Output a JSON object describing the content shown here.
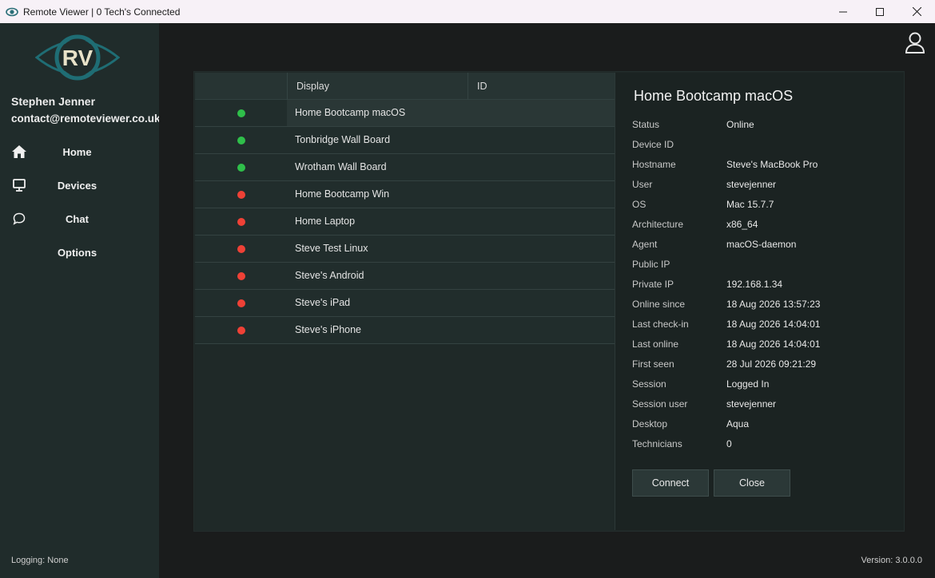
{
  "window": {
    "title": "Remote Viewer | 0 Tech's Connected"
  },
  "sidebar": {
    "logo_text": "RV",
    "user_name": "Stephen Jenner",
    "user_email": "contact@remoteviewer.co.uk",
    "nav": [
      {
        "label": "Home",
        "icon": "home-icon"
      },
      {
        "label": "Devices",
        "icon": "monitor-icon"
      },
      {
        "label": "Chat",
        "icon": "chat-icon"
      },
      {
        "label": "Options",
        "icon": ""
      }
    ],
    "logging": "Logging: None"
  },
  "footer": {
    "version": "Version: 3.0.0.0"
  },
  "table": {
    "columns": [
      "",
      "Display",
      "ID"
    ],
    "rows": [
      {
        "display": "Home Bootcamp macOS",
        "status": "online"
      },
      {
        "display": "Tonbridge Wall Board",
        "status": "online"
      },
      {
        "display": "Wrotham Wall Board",
        "status": "online"
      },
      {
        "display": "Home Bootcamp Win",
        "status": "offline"
      },
      {
        "display": "Home Laptop",
        "status": "offline"
      },
      {
        "display": "Steve Test Linux",
        "status": "offline"
      },
      {
        "display": "Steve's Android",
        "status": "offline"
      },
      {
        "display": "Steve's iPad",
        "status": "offline"
      },
      {
        "display": "Steve's iPhone",
        "status": "offline"
      }
    ],
    "selected_index": 0
  },
  "details": {
    "title": "Home Bootcamp macOS",
    "fields": [
      {
        "label": "Status",
        "value": "Online"
      },
      {
        "label": "Device ID",
        "value": ""
      },
      {
        "label": "Hostname",
        "value": "Steve's MacBook Pro"
      },
      {
        "label": "User",
        "value": "stevejenner"
      },
      {
        "label": "OS",
        "value": "Mac 15.7.7"
      },
      {
        "label": "Architecture",
        "value": "x86_64"
      },
      {
        "label": "Agent",
        "value": "macOS-daemon"
      },
      {
        "label": "Public IP",
        "value": ""
      },
      {
        "label": "Private IP",
        "value": "192.168.1.34"
      },
      {
        "label": "Online since",
        "value": "18 Aug 2026 13:57:23"
      },
      {
        "label": "Last check-in",
        "value": "18 Aug 2026 14:04:01"
      },
      {
        "label": "Last online",
        "value": "18 Aug 2026 14:04:01"
      },
      {
        "label": "First seen",
        "value": "28 Jul 2026 09:21:29"
      },
      {
        "label": "Session",
        "value": "Logged In"
      },
      {
        "label": "Session user",
        "value": "stevejenner"
      },
      {
        "label": "Desktop",
        "value": "Aqua"
      },
      {
        "label": "Technicians",
        "value": "0"
      }
    ],
    "connect_label": "Connect",
    "close_label": "Close"
  },
  "colors": {
    "online": "#2fbf4a",
    "offline": "#ef4136",
    "logo": "#1f6d74",
    "logo_text": "#e9e3c9"
  }
}
